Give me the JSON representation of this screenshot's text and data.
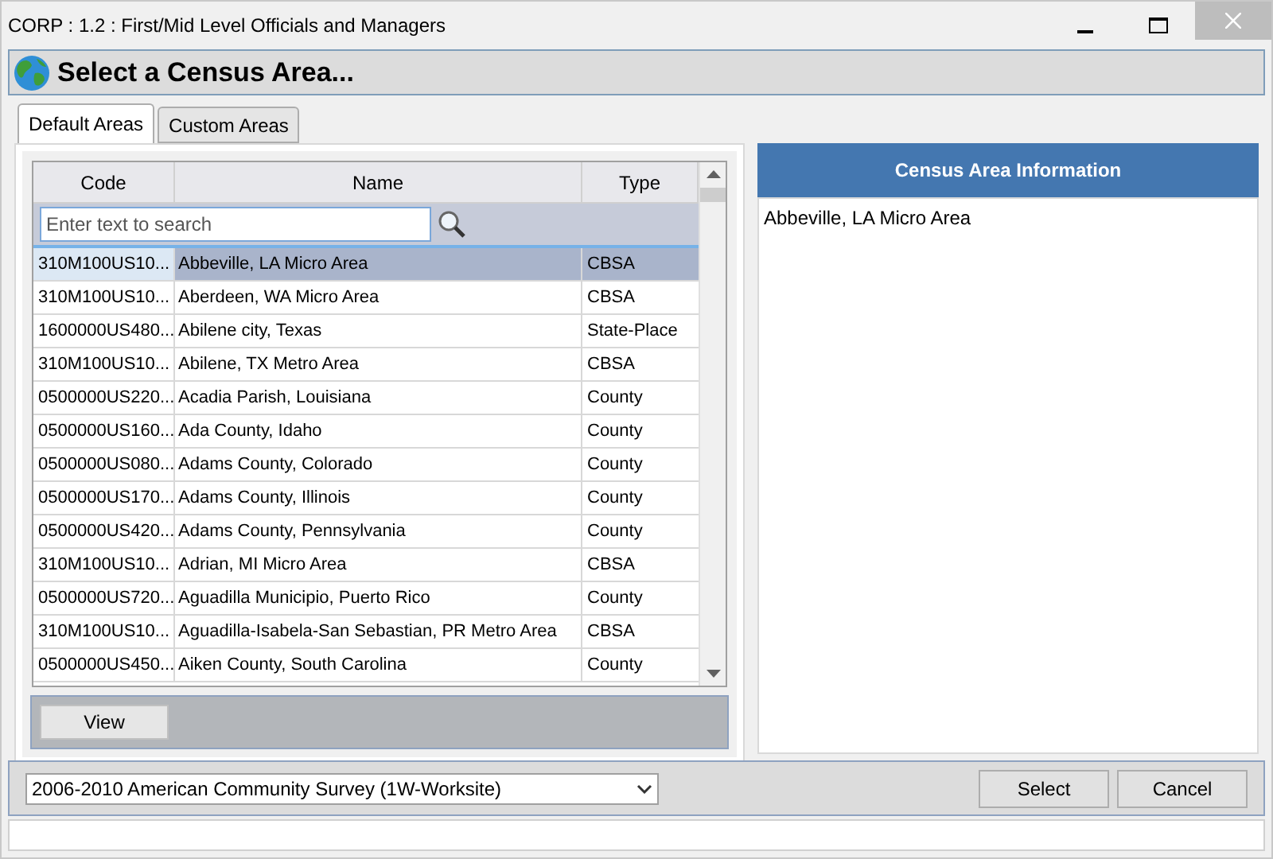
{
  "window": {
    "title": "CORP : 1.2 : First/Mid Level Officials and Managers"
  },
  "header": {
    "title": "Select a Census Area..."
  },
  "tabs": [
    {
      "label": "Default Areas",
      "selected": true
    },
    {
      "label": "Custom Areas",
      "selected": false
    }
  ],
  "table": {
    "columns": [
      "Code",
      "Name",
      "Type"
    ],
    "search": {
      "placeholder": "Enter text to search"
    },
    "rows": [
      {
        "code": "310M100US10...",
        "name": "Abbeville, LA Micro Area",
        "type": "CBSA",
        "selected": true
      },
      {
        "code": "310M100US10...",
        "name": "Aberdeen, WA Micro Area",
        "type": "CBSA",
        "selected": false
      },
      {
        "code": "1600000US480...",
        "name": "Abilene city, Texas",
        "type": "State-Place",
        "selected": false
      },
      {
        "code": "310M100US10...",
        "name": "Abilene, TX Metro Area",
        "type": "CBSA",
        "selected": false
      },
      {
        "code": "0500000US220...",
        "name": "Acadia Parish, Louisiana",
        "type": "County",
        "selected": false
      },
      {
        "code": "0500000US160...",
        "name": "Ada County, Idaho",
        "type": "County",
        "selected": false
      },
      {
        "code": "0500000US080...",
        "name": "Adams County, Colorado",
        "type": "County",
        "selected": false
      },
      {
        "code": "0500000US170...",
        "name": "Adams County, Illinois",
        "type": "County",
        "selected": false
      },
      {
        "code": "0500000US420...",
        "name": "Adams County, Pennsylvania",
        "type": "County",
        "selected": false
      },
      {
        "code": "310M100US10...",
        "name": "Adrian, MI Micro Area",
        "type": "CBSA",
        "selected": false
      },
      {
        "code": "0500000US720...",
        "name": "Aguadilla Municipio, Puerto Rico",
        "type": "County",
        "selected": false
      },
      {
        "code": "310M100US10...",
        "name": "Aguadilla-Isabela-San Sebastian, PR Metro Area",
        "type": "CBSA",
        "selected": false
      },
      {
        "code": "0500000US450...",
        "name": "Aiken County, South Carolina",
        "type": "County",
        "selected": false
      }
    ]
  },
  "view_button": "View",
  "info_panel": {
    "title": "Census Area Information",
    "text": "Abbeville, LA Micro Area"
  },
  "survey_dropdown": {
    "value": "2006-2010 American Community Survey (1W-Worksite)"
  },
  "buttons": [
    "Select",
    "Cancel"
  ]
}
